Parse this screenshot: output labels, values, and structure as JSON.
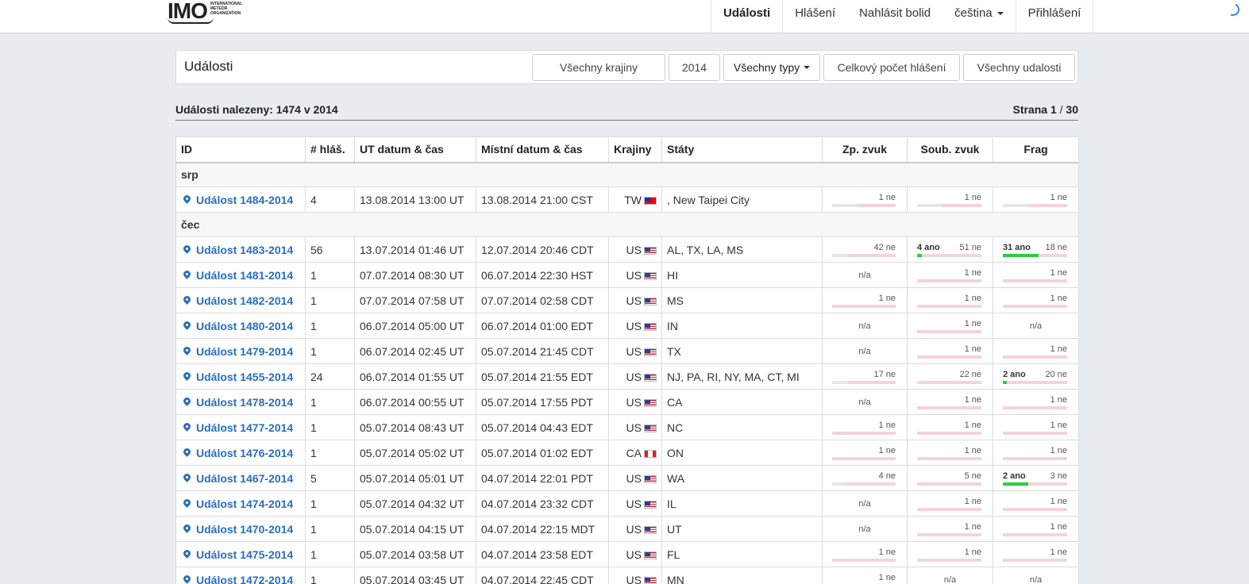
{
  "navbar": {
    "logo_text": "IMO",
    "logo_sub": "INTERNATIONAL METEOR ORGANIZATION",
    "items": [
      {
        "label": "Události",
        "active": true
      },
      {
        "label": "Hlášení"
      },
      {
        "label": "Nahlásit bolid"
      },
      {
        "label": "čeština"
      },
      {
        "label": "Přihlášení"
      }
    ]
  },
  "panel": {
    "title": "Události",
    "filters": {
      "country": "Všechny krajiny",
      "year": "2014",
      "types": "Všechny typy",
      "total_reports": "Celkový počet hlášení",
      "all_events": "Všechny udalosti"
    }
  },
  "results": {
    "count_text": "Události nalezeny: 1474 v 2014",
    "page_label": "Strana",
    "page_current": "1",
    "page_sep": "/",
    "page_total": "30"
  },
  "table": {
    "headers": [
      "ID",
      "# hláš.",
      "UT datum & čas",
      "Místní datum & čas",
      "Krajiny",
      "Státy",
      "Zp. zvuk",
      "Soub. zvuk",
      "Frag"
    ],
    "groups": [
      {
        "label": "srp",
        "rows": [
          {
            "id": "Událost 1484-2014",
            "reports": "4",
            "ut": "13.08.2014 13:00 UT",
            "local": "13.08.2014 21:00 CST",
            "country": "TW",
            "flag": "tw",
            "states": ", New Taipei City",
            "delayed": {
              "yes": "",
              "no": "1 ne",
              "gray": 0.4
            },
            "simul": {
              "yes": "",
              "no": "1 ne",
              "gray": 0.4
            },
            "frag": {
              "yes": "",
              "no": "1 ne",
              "gray": 0.4
            }
          }
        ]
      },
      {
        "label": "čec",
        "rows": [
          {
            "id": "Událost 1483-2014",
            "reports": "56",
            "ut": "13.07.2014 01:46 UT",
            "local": "12.07.2014 20:46 CDT",
            "country": "US",
            "flag": "us",
            "states": "AL, TX, LA, MS",
            "delayed": {
              "yes": "",
              "no": "42 ne",
              "gray": 0.25
            },
            "simul": {
              "yes": "4 ano",
              "no": "51 ne",
              "green": 0.07
            },
            "frag": {
              "yes": "31 ano",
              "no": "18 ne",
              "green": 0.55
            }
          },
          {
            "id": "Událost 1481-2014",
            "reports": "1",
            "ut": "07.07.2014 08:30 UT",
            "local": "06.07.2014 22:30 HST",
            "country": "US",
            "flag": "us",
            "states": "HI",
            "delayed": {
              "na": "n/a"
            },
            "simul": {
              "yes": "",
              "no": "1 ne"
            },
            "frag": {
              "yes": "",
              "no": "1 ne"
            }
          },
          {
            "id": "Událost 1482-2014",
            "reports": "1",
            "ut": "07.07.2014 07:58 UT",
            "local": "07.07.2014 02:58 CDT",
            "country": "US",
            "flag": "us",
            "states": "MS",
            "delayed": {
              "yes": "",
              "no": "1 ne"
            },
            "simul": {
              "yes": "",
              "no": "1 ne"
            },
            "frag": {
              "yes": "",
              "no": "1 ne"
            }
          },
          {
            "id": "Událost 1480-2014",
            "reports": "1",
            "ut": "06.07.2014 05:00 UT",
            "local": "06.07.2014 01:00 EDT",
            "country": "US",
            "flag": "us",
            "states": "IN",
            "delayed": {
              "na": "n/a"
            },
            "simul": {
              "yes": "",
              "no": "1 ne"
            },
            "frag": {
              "na": "n/a"
            }
          },
          {
            "id": "Událost 1479-2014",
            "reports": "1",
            "ut": "06.07.2014 02:45 UT",
            "local": "05.07.2014 21:45 CDT",
            "country": "US",
            "flag": "us",
            "states": "TX",
            "delayed": {
              "na": "n/a"
            },
            "simul": {
              "yes": "",
              "no": "1 ne"
            },
            "frag": {
              "yes": "",
              "no": "1 ne"
            }
          },
          {
            "id": "Událost 1455-2014",
            "reports": "24",
            "ut": "06.07.2014 01:55 UT",
            "local": "05.07.2014 21:55 EDT",
            "country": "US",
            "flag": "us",
            "states": "NJ, PA, RI, NY, MA, CT, MI",
            "delayed": {
              "yes": "",
              "no": "17 ne",
              "gray": 0.25
            },
            "simul": {
              "yes": "",
              "no": "22 ne",
              "gray": 0.05
            },
            "frag": {
              "yes": "2 ano",
              "no": "20 ne",
              "green": 0.06
            }
          },
          {
            "id": "Událost 1478-2014",
            "reports": "1",
            "ut": "06.07.2014 00:55 UT",
            "local": "05.07.2014 17:55 PDT",
            "country": "US",
            "flag": "us",
            "states": "CA",
            "delayed": {
              "na": "n/a"
            },
            "simul": {
              "yes": "",
              "no": "1 ne"
            },
            "frag": {
              "yes": "",
              "no": "1 ne"
            }
          },
          {
            "id": "Událost 1477-2014",
            "reports": "1",
            "ut": "05.07.2014 08:43 UT",
            "local": "05.07.2014 04:43 EDT",
            "country": "US",
            "flag": "us",
            "states": "NC",
            "delayed": {
              "yes": "",
              "no": "1 ne"
            },
            "simul": {
              "yes": "",
              "no": "1 ne"
            },
            "frag": {
              "yes": "",
              "no": "1 ne"
            }
          },
          {
            "id": "Událost 1476-2014",
            "reports": "1",
            "ut": "05.07.2014 05:02 UT",
            "local": "05.07.2014 01:02 EDT",
            "country": "CA",
            "flag": "ca",
            "states": "ON",
            "delayed": {
              "yes": "",
              "no": "1 ne"
            },
            "simul": {
              "yes": "",
              "no": "1 ne"
            },
            "frag": {
              "yes": "",
              "no": "1 ne"
            }
          },
          {
            "id": "Událost 1467-2014",
            "reports": "5",
            "ut": "05.07.2014 05:01 UT",
            "local": "04.07.2014 22:01 PDT",
            "country": "US",
            "flag": "us",
            "states": "WA",
            "delayed": {
              "yes": "",
              "no": "4 ne",
              "gray": 0.2
            },
            "simul": {
              "yes": "",
              "no": "5 ne"
            },
            "frag": {
              "yes": "2 ano",
              "no": "3 ne",
              "green": 0.4
            }
          },
          {
            "id": "Událost 1474-2014",
            "reports": "1",
            "ut": "05.07.2014 04:32 UT",
            "local": "04.07.2014 23:32 CDT",
            "country": "US",
            "flag": "us",
            "states": "IL",
            "delayed": {
              "na": "n/a"
            },
            "simul": {
              "yes": "",
              "no": "1 ne"
            },
            "frag": {
              "yes": "",
              "no": "1 ne"
            }
          },
          {
            "id": "Událost 1470-2014",
            "reports": "1",
            "ut": "05.07.2014 04:15 UT",
            "local": "04.07.2014 22:15 MDT",
            "country": "US",
            "flag": "us",
            "states": "UT",
            "delayed": {
              "na": "n/a"
            },
            "simul": {
              "yes": "",
              "no": "1 ne"
            },
            "frag": {
              "yes": "",
              "no": "1 ne"
            }
          },
          {
            "id": "Událost 1475-2014",
            "reports": "1",
            "ut": "05.07.2014 03:58 UT",
            "local": "04.07.2014 23:58 EDT",
            "country": "US",
            "flag": "us",
            "states": "FL",
            "delayed": {
              "yes": "",
              "no": "1 ne"
            },
            "simul": {
              "yes": "",
              "no": "1 ne"
            },
            "frag": {
              "yes": "",
              "no": "1 ne"
            }
          },
          {
            "id": "Událost 1472-2014",
            "reports": "1",
            "ut": "05.07.2014 03:45 UT",
            "local": "04.07.2014 22:45 CDT",
            "country": "US",
            "flag": "us",
            "states": "MN",
            "delayed": {
              "yes": "",
              "no": "1 ne"
            },
            "simul": {
              "na": "n/a"
            },
            "frag": {
              "na": "n/a"
            }
          }
        ]
      }
    ]
  }
}
